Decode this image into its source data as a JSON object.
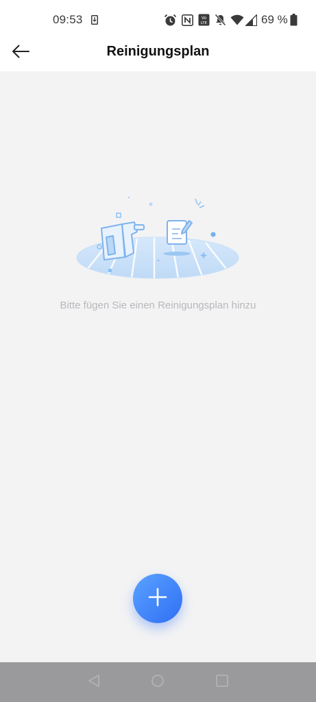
{
  "status_bar": {
    "time": "09:53",
    "battery_percent": "69 %",
    "icons": [
      "download-icon",
      "alarm-icon",
      "nfc-icon",
      "volte-icon",
      "mute-icon",
      "wifi-icon",
      "signal-icon",
      "battery-icon"
    ]
  },
  "app_bar": {
    "title": "Reinigungsplan",
    "back_icon": "back-arrow-icon"
  },
  "empty_state": {
    "message": "Bitte fügen Sie einen Reinigungsplan hinzu",
    "illustration": "vacuum-and-note-illustration"
  },
  "fab": {
    "icon": "plus-icon"
  },
  "nav_bar": {
    "buttons": [
      "nav-back-icon",
      "nav-home-icon",
      "nav-recents-icon"
    ]
  },
  "colors": {
    "accent": "#3b7df7",
    "background": "#f3f3f4",
    "illustration": "#8cc0f2",
    "navbar": "#9a9a9c"
  }
}
